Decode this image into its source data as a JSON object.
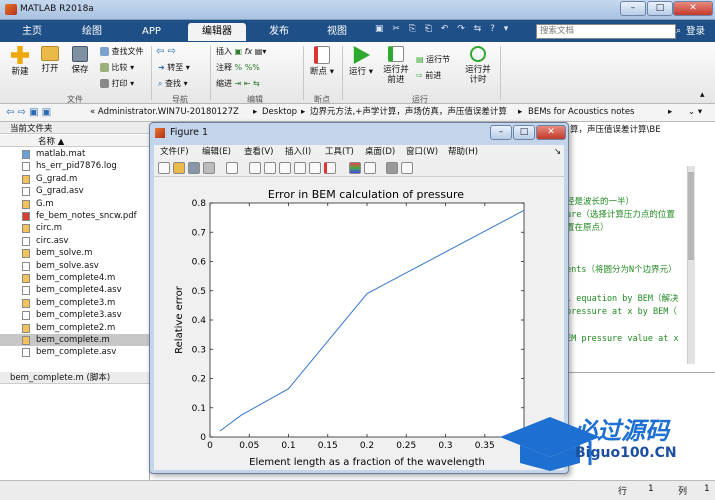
{
  "app": {
    "title": "MATLAB R2018a",
    "window_controls": {
      "minimize": "–",
      "maximize": "□",
      "close": "✕"
    }
  },
  "tabs": [
    "主页",
    "绘图",
    "APP",
    "编辑器",
    "发布",
    "视图"
  ],
  "active_tab": "编辑器",
  "search": {
    "placeholder": "搜索文档"
  },
  "login": "登录",
  "ribbon": {
    "file_buttons": [
      "新建",
      "打开",
      "保存"
    ],
    "file_small": [
      "查找文件",
      "比较",
      "打印"
    ],
    "nav_small": [
      "转至",
      "查找"
    ],
    "edit_small": [
      "插入",
      "注释",
      "缩进"
    ],
    "breakpoint": "断点",
    "run": "运行",
    "run_advance": [
      "运行并",
      "前进"
    ],
    "run_section": "运行节",
    "advance": "前进",
    "run_time": [
      "运行并",
      "计时"
    ],
    "groups": [
      "文件",
      "导航",
      "编辑",
      "断点",
      "运行"
    ]
  },
  "address": {
    "path": [
      "« Administrator.WIN7U-20180127Z",
      "Desktop",
      "边界元方法,+声学计算，声场仿真，声压值误差计算",
      "BEMs for Acoustics notes"
    ]
  },
  "current_folder": {
    "title": "当前文件夹",
    "column": "名称 ▲",
    "files": [
      {
        "name": "matlab.mat",
        "icon": "mat-file-icon"
      },
      {
        "name": "hs_err_pid7876.log",
        "icon": "text-file-icon"
      },
      {
        "name": "G_grad.m",
        "icon": "m-file-icon"
      },
      {
        "name": "G_grad.asv",
        "icon": "text-file-icon"
      },
      {
        "name": "G.m",
        "icon": "m-file-icon"
      },
      {
        "name": "fe_bem_notes_sncw.pdf",
        "icon": "pdf-file-icon"
      },
      {
        "name": "circ.m",
        "icon": "m-file-icon"
      },
      {
        "name": "circ.asv",
        "icon": "text-file-icon"
      },
      {
        "name": "bem_solve.m",
        "icon": "m-file-icon"
      },
      {
        "name": "bem_solve.asv",
        "icon": "text-file-icon"
      },
      {
        "name": "bem_complete4.m",
        "icon": "m-file-icon"
      },
      {
        "name": "bem_complete4.asv",
        "icon": "text-file-icon"
      },
      {
        "name": "bem_complete3.m",
        "icon": "m-file-icon"
      },
      {
        "name": "bem_complete3.asv",
        "icon": "text-file-icon"
      },
      {
        "name": "bem_complete2.m",
        "icon": "m-file-icon"
      },
      {
        "name": "bem_complete.m",
        "icon": "m-file-icon"
      },
      {
        "name": "bem_complete.asv",
        "icon": "text-file-icon"
      }
    ],
    "selected": "bem_complete.m",
    "detail": "bem_complete.m  (脚本)"
  },
  "editor": {
    "header_fragment": "算，声压值误差计算\\BE",
    "lines": [
      "经是波长的一半）",
      "ure（选择计算压力点的位置",
      "置在原点）",
      "ents（将圆分为N个边界元）",
      "l equation by BEM（解决",
      "pressure at x by BEM（",
      "EM pressure value at x"
    ]
  },
  "status_bar": {
    "row_label": "行",
    "row": "1",
    "col_label": "列",
    "col": "1"
  },
  "figure": {
    "title": "Figure 1",
    "menu": [
      "文件(F)",
      "编辑(E)",
      "查看(V)",
      "插入(I)",
      "工具(T)",
      "桌面(D)",
      "窗口(W)",
      "帮助(H)"
    ]
  },
  "chart_data": {
    "type": "line",
    "title": "Error in BEM calculation of pressure",
    "xlabel": "Element length as a fraction of the wavelength",
    "ylabel": "Relative error",
    "xlim": [
      0,
      0.4
    ],
    "ylim": [
      0,
      0.8
    ],
    "xticks": [
      "0",
      "0.05",
      "0.1",
      "0.15",
      "0.2",
      "0.25",
      "0.3",
      "0.35"
    ],
    "yticks": [
      "0",
      "0.1",
      "0.2",
      "0.3",
      "0.4",
      "0.5",
      "0.6",
      "0.7",
      "0.8"
    ],
    "grid": false,
    "color": "#3477c9",
    "x": [
      0.0125,
      0.04,
      0.1,
      0.2,
      0.4
    ],
    "y": [
      0.02,
      0.075,
      0.165,
      0.49,
      0.775
    ]
  },
  "watermark": {
    "big": "必过源码",
    "small": "Biguo100.CN"
  }
}
